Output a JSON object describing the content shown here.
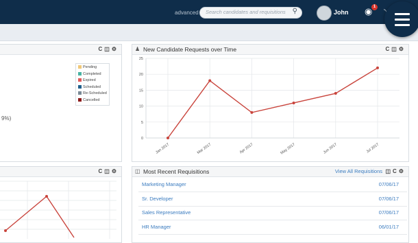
{
  "header": {
    "advanced_label": "advanced",
    "search_placeholder": "Search candidates and requisitions",
    "user_name": "John",
    "notification_count": "1"
  },
  "status_panel": {
    "legend": [
      {
        "label": "Pending",
        "color": "#f0c878"
      },
      {
        "label": "Completed",
        "color": "#49b3a3"
      },
      {
        "label": "Expired",
        "color": "#e05a5a"
      },
      {
        "label": "Scheduled",
        "color": "#1f5f8b"
      },
      {
        "label": "Re-Scheduled",
        "color": "#7a8a96"
      },
      {
        "label": "Cancelled",
        "color": "#8b1a1a"
      }
    ],
    "percent_fragment": "9%)"
  },
  "candidate_panel": {
    "title": "New Candidate Requests over Time"
  },
  "requisitions_panel": {
    "title": "Most Recent Requisitions",
    "view_all": "View All Requisitions",
    "rows": [
      {
        "title": "Marketing Manager",
        "date": "07/06/17"
      },
      {
        "title": "Sr. Developer",
        "date": "07/06/17"
      },
      {
        "title": "Sales Representative",
        "date": "07/06/17"
      },
      {
        "title": "HR Manager",
        "date": "06/01/17"
      }
    ]
  },
  "chart_data": [
    {
      "type": "line",
      "title": "New Candidate Requests over Time",
      "categories": [
        "Jan 2017",
        "Mar 2017",
        "Apr 2017",
        "May 2017",
        "Jun 2017",
        "Jul 2017"
      ],
      "values": [
        0,
        18,
        8,
        11,
        14,
        22
      ],
      "yticks": [
        0,
        5,
        10,
        15,
        20,
        25
      ],
      "ylim": [
        0,
        25
      ],
      "line_color": "#c9443c",
      "grid": true
    },
    {
      "type": "line",
      "partial": true,
      "values": [
        null,
        17,
        null
      ],
      "line_color": "#c9443c",
      "grid": true
    }
  ]
}
